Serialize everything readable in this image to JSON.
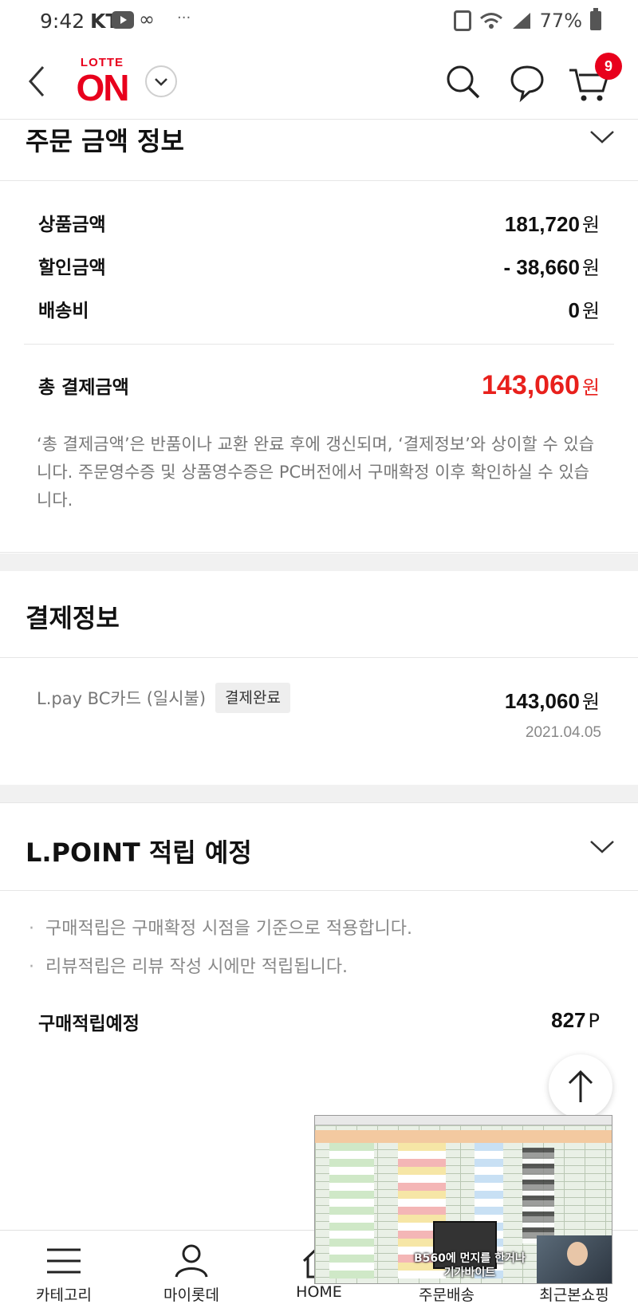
{
  "status_bar": {
    "time": "9:42",
    "carrier": "KT",
    "dots": "···",
    "battery": "77%"
  },
  "header": {
    "logo_top": "LOTTE",
    "logo_main": "ON",
    "cart_count": "9",
    "brand_color": "#e8001c"
  },
  "order_amount": {
    "title": "주문 금액 정보",
    "rows": [
      {
        "label": "상품금액",
        "value": "181,720",
        "unit": "원"
      },
      {
        "label": "할인금액",
        "value": "- 38,660",
        "unit": "원"
      },
      {
        "label": "배송비",
        "value": "0",
        "unit": "원"
      }
    ],
    "total_label": "총 결제금액",
    "total_value": "143,060",
    "total_unit": "원",
    "total_color": "#e8201c",
    "notice": "‘총 결제금액’은 반품이나 교환 완료 후에 갱신되며, ‘결제정보’와 상이할 수 있습니다. 주문영수증 및 상품영수증은 PC버전에서 구매확정 이후 확인하실 수 있습니다."
  },
  "payment_info": {
    "title": "결제정보",
    "method": "L.pay BC카드 (일시불)",
    "status_badge": "결제완료",
    "amount": "143,060",
    "unit": "원",
    "date": "2021.04.05"
  },
  "lpoint": {
    "title": "L.POINT 적립 예정",
    "bullets": [
      "구매적립은 구매확정 시점을 기준으로 적용합니다.",
      "리뷰적립은 리뷰 작성 시에만 적립됩니다."
    ],
    "expected_label": "구매적립예정",
    "expected_value": "827",
    "expected_unit": "P"
  },
  "bottom_nav": {
    "items": [
      {
        "label": "카테고리",
        "icon": "menu-icon"
      },
      {
        "label": "마이롯데",
        "icon": "person-icon"
      },
      {
        "label": "HOME",
        "icon": "home-icon"
      },
      {
        "label": "주문배송",
        "icon": "delivery-icon"
      },
      {
        "label": "최근본쇼핑",
        "icon": "recent-icon"
      }
    ]
  },
  "pip_video": {
    "caption_line1": "B560에 먼지를 한거나",
    "caption_line2": "기가바이트"
  }
}
